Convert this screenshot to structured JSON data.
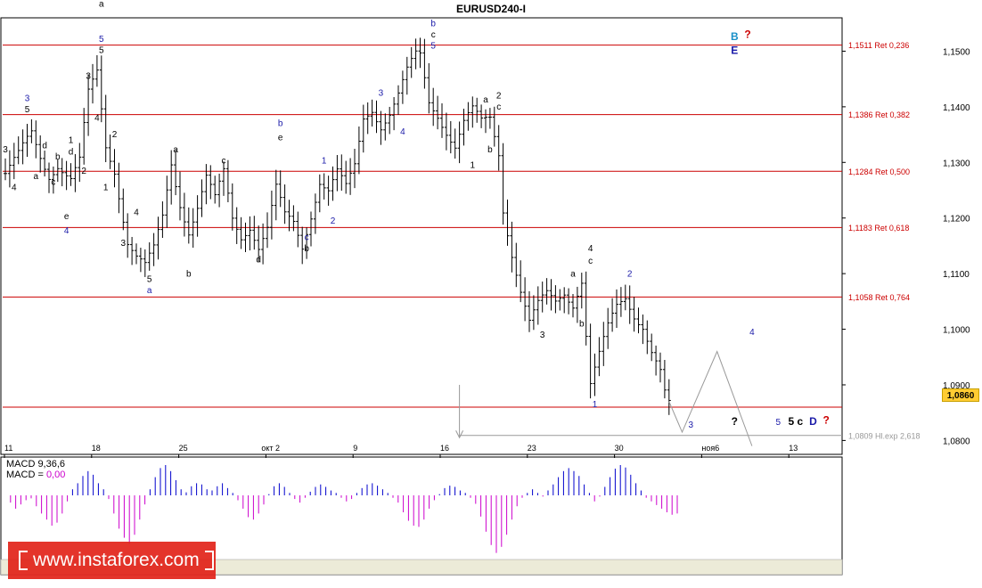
{
  "title": "EURUSD240-I",
  "brand_text": "www.instaforex.com",
  "macd": {
    "params_label": "MACD 9,36,6",
    "value_label": "MACD =",
    "value": "0,00",
    "positive_color": "#0000cc",
    "negative_color": "#cc00cc"
  },
  "current_price_label": "1,0860",
  "chart_data": {
    "type": "candlestick",
    "ylim": [
      1.0775,
      1.156
    ],
    "grid": false,
    "x_ticks": [
      "11",
      "18",
      "25",
      "окт 2",
      "9",
      "16",
      "23",
      "30",
      "ноя6",
      "13"
    ],
    "y_ticks": [
      "1,1500",
      "1,1400",
      "1,1300",
      "1,1200",
      "1,1100",
      "1,1000",
      "1,0900",
      "1,0800"
    ],
    "price_path": [
      [
        0,
        1.128
      ],
      [
        3,
        1.131
      ],
      [
        6,
        1.135
      ],
      [
        8,
        1.131
      ],
      [
        10,
        1.128
      ],
      [
        12,
        1.13
      ],
      [
        15,
        1.127
      ],
      [
        17,
        1.13
      ],
      [
        19,
        1.142
      ],
      [
        21,
        1.146
      ],
      [
        23,
        1.133
      ],
      [
        25,
        1.129
      ],
      [
        28,
        1.116
      ],
      [
        30,
        1.113
      ],
      [
        32,
        1.111
      ],
      [
        34,
        1.114
      ],
      [
        36,
        1.12
      ],
      [
        38,
        1.13
      ],
      [
        40,
        1.123
      ],
      [
        42,
        1.118
      ],
      [
        44,
        1.122
      ],
      [
        46,
        1.127
      ],
      [
        48,
        1.123
      ],
      [
        50,
        1.128
      ],
      [
        52,
        1.12
      ],
      [
        54,
        1.117
      ],
      [
        56,
        1.119
      ],
      [
        58,
        1.115
      ],
      [
        60,
        1.118
      ],
      [
        62,
        1.125
      ],
      [
        64,
        1.12
      ],
      [
        66,
        1.119
      ],
      [
        68,
        1.115
      ],
      [
        70,
        1.121
      ],
      [
        72,
        1.127
      ],
      [
        74,
        1.125
      ],
      [
        76,
        1.128
      ],
      [
        78,
        1.125
      ],
      [
        80,
        1.129
      ],
      [
        82,
        1.138
      ],
      [
        84,
        1.14
      ],
      [
        86,
        1.137
      ],
      [
        88,
        1.139
      ],
      [
        90,
        1.142
      ],
      [
        92,
        1.146
      ],
      [
        94,
        1.149
      ],
      [
        95,
        1.149
      ],
      [
        97,
        1.141
      ],
      [
        99,
        1.139
      ],
      [
        101,
        1.136
      ],
      [
        103,
        1.133
      ],
      [
        105,
        1.137
      ],
      [
        107,
        1.139
      ],
      [
        109,
        1.137
      ],
      [
        111,
        1.138
      ],
      [
        113,
        1.132
      ],
      [
        114,
        1.122
      ],
      [
        116,
        1.114
      ],
      [
        118,
        1.107
      ],
      [
        120,
        1.101
      ],
      [
        122,
        1.104
      ],
      [
        124,
        1.106
      ],
      [
        126,
        1.105
      ],
      [
        128,
        1.107
      ],
      [
        130,
        1.105
      ],
      [
        132,
        1.109
      ],
      [
        133,
        1.099
      ],
      [
        134,
        1.09
      ],
      [
        136,
        1.095
      ],
      [
        138,
        1.1
      ],
      [
        140,
        1.104
      ],
      [
        142,
        1.106
      ],
      [
        144,
        1.103
      ],
      [
        146,
        1.101
      ],
      [
        148,
        1.096
      ],
      [
        150,
        1.092
      ],
      [
        151,
        1.088
      ],
      [
        152,
        1.086
      ]
    ],
    "horizontal_lines": [
      {
        "value": 1.1511,
        "label": "1,1511 Ret 0,236",
        "color": "#cc0000"
      },
      {
        "value": 1.1386,
        "label": "1,1386 Ret 0,382",
        "color": "#cc0000"
      },
      {
        "value": 1.1284,
        "label": "1,1284 Ret 0,500",
        "color": "#cc0000"
      },
      {
        "value": 1.1183,
        "label": "1,1183 Ret 0,618",
        "color": "#cc0000"
      },
      {
        "value": 1.1058,
        "label": "1,1058 Ret 0,764",
        "color": "#cc0000"
      },
      {
        "value": 1.086,
        "label": "",
        "color": "#cc0000"
      },
      {
        "value": 1.0809,
        "label": "1,0809 Hl.exp 2,618",
        "color": "#999999",
        "from_bar": 104
      }
    ],
    "projection": [
      [
        152,
        1.087
      ],
      [
        155,
        1.0815
      ],
      [
        163,
        1.096
      ],
      [
        171,
        1.079
      ]
    ],
    "arrow": {
      "bar": 104,
      "from": 1.09,
      "to": 1.0805
    },
    "wave_labels": [
      {
        "t": "3",
        "bar": 0,
        "y": 1.1318,
        "c": "#000"
      },
      {
        "t": "4",
        "bar": 2,
        "y": 1.125,
        "c": "#000"
      },
      {
        "t": "3",
        "bar": 5,
        "y": 1.141,
        "c": "#1a1aa8"
      },
      {
        "t": "5",
        "bar": 5,
        "y": 1.139,
        "c": "#000"
      },
      {
        "t": "a",
        "bar": 7,
        "y": 1.127,
        "c": "#000"
      },
      {
        "t": "d",
        "bar": 9,
        "y": 1.1325,
        "c": "#000"
      },
      {
        "t": "c",
        "bar": 11,
        "y": 1.126,
        "c": "#000"
      },
      {
        "t": "e",
        "bar": 14,
        "y": 1.1198,
        "c": "#000"
      },
      {
        "t": "4",
        "bar": 14,
        "y": 1.1172,
        "c": "#1a1aa8"
      },
      {
        "t": "b",
        "bar": 12,
        "y": 1.1305,
        "c": "#000"
      },
      {
        "t": "1",
        "bar": 15,
        "y": 1.1335,
        "c": "#000"
      },
      {
        "t": "d",
        "bar": 15,
        "y": 1.1314,
        "c": "#000"
      },
      {
        "t": "2",
        "bar": 18,
        "y": 1.128,
        "c": "#000"
      },
      {
        "t": "3",
        "bar": 19,
        "y": 1.145,
        "c": "#000"
      },
      {
        "t": "a",
        "bar": 22,
        "y": 1.158,
        "c": "#000"
      },
      {
        "t": "5",
        "bar": 22,
        "y": 1.1517,
        "c": "#1a1aa8"
      },
      {
        "t": "5",
        "bar": 22,
        "y": 1.1497,
        "c": "#000"
      },
      {
        "t": "4",
        "bar": 21,
        "y": 1.1375,
        "c": "#000"
      },
      {
        "t": "2",
        "bar": 25,
        "y": 1.1345,
        "c": "#000"
      },
      {
        "t": "1",
        "bar": 23,
        "y": 1.125,
        "c": "#000"
      },
      {
        "t": "3",
        "bar": 27,
        "y": 1.115,
        "c": "#000"
      },
      {
        "t": "4",
        "bar": 30,
        "y": 1.1205,
        "c": "#000"
      },
      {
        "t": "5",
        "bar": 33,
        "y": 1.1085,
        "c": "#000"
      },
      {
        "t": "a",
        "bar": 33,
        "y": 1.1065,
        "c": "#1a1aa8"
      },
      {
        "t": "a",
        "bar": 39,
        "y": 1.1318,
        "c": "#000"
      },
      {
        "t": "b",
        "bar": 42,
        "y": 1.1095,
        "c": "#000"
      },
      {
        "t": "c",
        "bar": 50,
        "y": 1.1298,
        "c": "#000"
      },
      {
        "t": "d",
        "bar": 58,
        "y": 1.112,
        "c": "#000"
      },
      {
        "t": "b",
        "bar": 63,
        "y": 1.1365,
        "c": "#1a1aa8"
      },
      {
        "t": "e",
        "bar": 63,
        "y": 1.134,
        "c": "#000"
      },
      {
        "t": "1",
        "bar": 73,
        "y": 1.1298,
        "c": "#1a1aa8"
      },
      {
        "t": "2",
        "bar": 75,
        "y": 1.119,
        "c": "#1a1aa8"
      },
      {
        "t": "c",
        "bar": 69,
        "y": 1.116,
        "c": "#1a1aa8"
      },
      {
        "t": "b",
        "bar": 69,
        "y": 1.114,
        "c": "#000"
      },
      {
        "t": "3",
        "bar": 86,
        "y": 1.142,
        "c": "#1a1aa8"
      },
      {
        "t": "4",
        "bar": 91,
        "y": 1.135,
        "c": "#1a1aa8"
      },
      {
        "t": "b",
        "bar": 98,
        "y": 1.1545,
        "c": "#1a1aa8"
      },
      {
        "t": "c",
        "bar": 98,
        "y": 1.1525,
        "c": "#000"
      },
      {
        "t": "5",
        "bar": 98,
        "y": 1.1505,
        "c": "#1a1aa8"
      },
      {
        "t": "a",
        "bar": 110,
        "y": 1.1408,
        "c": "#000"
      },
      {
        "t": "2",
        "bar": 113,
        "y": 1.1415,
        "c": "#000"
      },
      {
        "t": "c",
        "bar": 113,
        "y": 1.1395,
        "c": "#000"
      },
      {
        "t": "b",
        "bar": 111,
        "y": 1.1318,
        "c": "#000"
      },
      {
        "t": "1",
        "bar": 107,
        "y": 1.129,
        "c": "#000"
      },
      {
        "t": "3",
        "bar": 123,
        "y": 1.0985,
        "c": "#000"
      },
      {
        "t": "a",
        "bar": 130,
        "y": 1.1095,
        "c": "#000"
      },
      {
        "t": "4",
        "bar": 134,
        "y": 1.114,
        "c": "#000"
      },
      {
        "t": "c",
        "bar": 134,
        "y": 1.1118,
        "c": "#000"
      },
      {
        "t": "b",
        "bar": 132,
        "y": 1.1005,
        "c": "#000"
      },
      {
        "t": "2",
        "bar": 143,
        "y": 1.1095,
        "c": "#1a1aa8"
      },
      {
        "t": "1",
        "bar": 135,
        "y": 1.086,
        "c": "#1a1aa8"
      },
      {
        "t": "3",
        "bar": 157,
        "y": 1.0823,
        "c": "#1a1aa8"
      },
      {
        "t": "?",
        "bar": 167,
        "y": 1.0828,
        "c": "#000"
      },
      {
        "t": "4",
        "bar": 171,
        "y": 1.099,
        "c": "#1a1aa8"
      },
      {
        "t": "5",
        "bar": 177,
        "y": 1.0828,
        "c": "#1a1aa8"
      },
      {
        "t": "5 c",
        "bar": 181,
        "y": 1.0828,
        "c": "#000"
      },
      {
        "t": "D",
        "bar": 185,
        "y": 1.0828,
        "c": "#1a1aa8"
      },
      {
        "t": "?",
        "bar": 188,
        "y": 1.083,
        "c": "#cc0000"
      },
      {
        "t": "B",
        "bar": 167,
        "y": 1.152,
        "c": "#1a90c8"
      },
      {
        "t": "?",
        "bar": 170,
        "y": 1.1524,
        "c": "#cc0000"
      },
      {
        "t": "E",
        "bar": 167,
        "y": 1.1495,
        "c": "#1a1aa8"
      }
    ],
    "macd_values": [
      0.0,
      -0.0012,
      -0.0022,
      -0.0015,
      -0.0008,
      -0.0005,
      -0.0018,
      -0.003,
      -0.004,
      -0.005,
      -0.0045,
      -0.003,
      -0.001,
      0.001,
      0.002,
      0.0032,
      0.004,
      0.0034,
      0.002,
      0.001,
      -0.0006,
      -0.003,
      -0.0055,
      -0.007,
      -0.008,
      -0.0065,
      -0.004,
      -0.0015,
      0.001,
      0.003,
      0.0045,
      0.005,
      0.004,
      0.0025,
      0.001,
      0.0005,
      0.0015,
      0.002,
      0.0018,
      0.001,
      0.0008,
      0.0015,
      0.002,
      0.0012,
      0.0004,
      -0.0008,
      -0.0022,
      -0.0036,
      -0.004,
      -0.003,
      -0.0015,
      0.0002,
      0.0015,
      0.002,
      0.0014,
      0.0004,
      -0.0006,
      -0.0012,
      -0.0004,
      0.0006,
      0.0014,
      0.0018,
      0.0014,
      0.0008,
      0.0004,
      -0.0004,
      -0.001,
      -0.0006,
      0.0004,
      0.0012,
      0.0018,
      0.002,
      0.0016,
      0.001,
      0.0004,
      -0.0004,
      -0.0012,
      -0.0028,
      -0.0042,
      -0.005,
      -0.0052,
      -0.004,
      -0.0022,
      -0.0008,
      0.0002,
      0.0012,
      0.0016,
      0.0014,
      0.0008,
      0.0004,
      -0.0004,
      -0.0014,
      -0.0035,
      -0.006,
      -0.0082,
      -0.0095,
      -0.0085,
      -0.0065,
      -0.004,
      -0.0018,
      -0.0004,
      0.0004,
      0.001,
      0.0004,
      -0.0002,
      0.0008,
      0.0018,
      0.003,
      0.004,
      0.0045,
      0.004,
      0.0032,
      0.0018,
      0.0004,
      -0.001,
      -0.0002,
      0.0014,
      0.003,
      0.0044,
      0.005,
      0.0046,
      0.0034,
      0.002,
      0.0008,
      -0.0004,
      -0.001,
      -0.0016,
      -0.0022,
      -0.0028,
      -0.0032,
      -0.003
    ]
  }
}
